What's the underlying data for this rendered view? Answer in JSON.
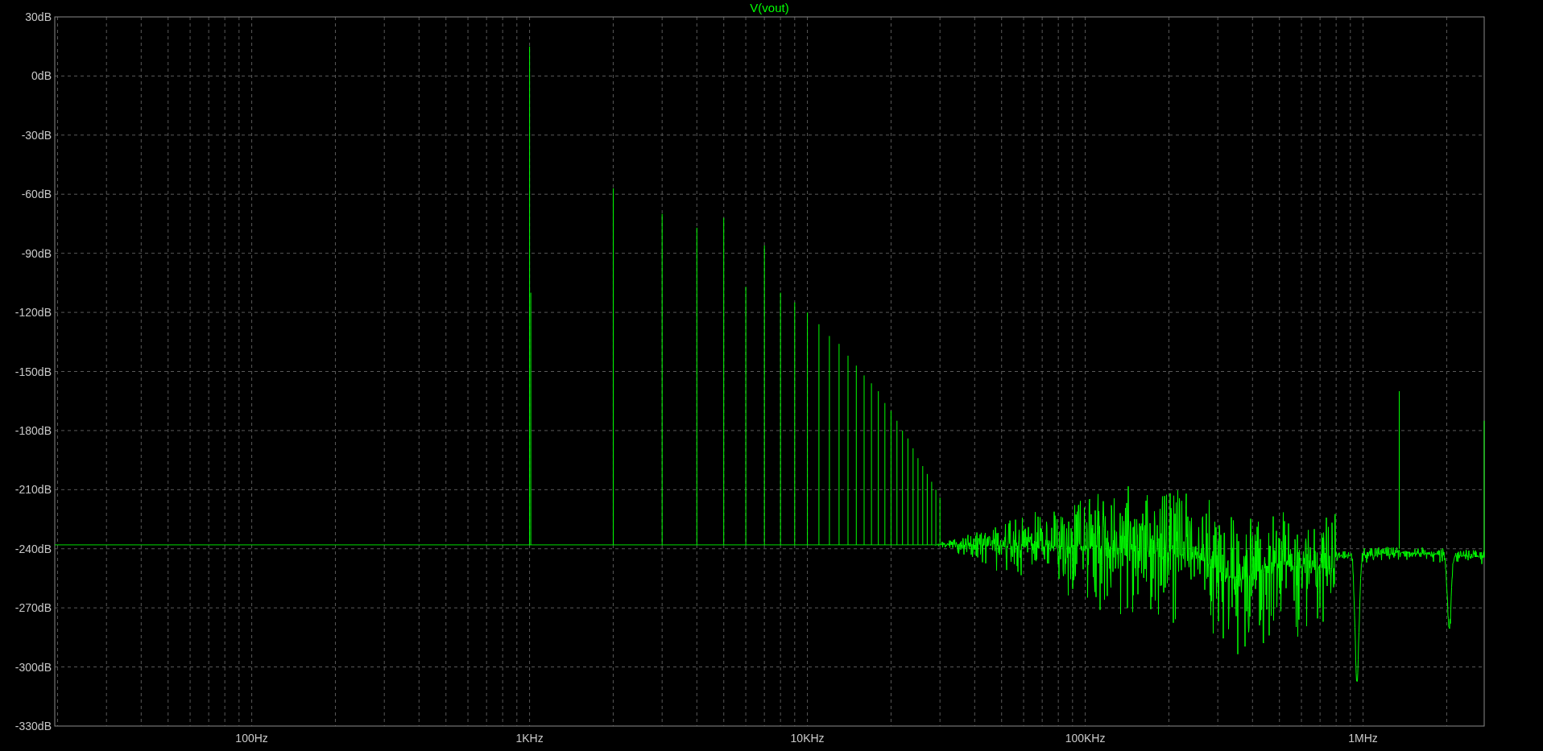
{
  "plot": {
    "title": "V(vout)",
    "y_ticks": [
      "30dB",
      "0dB",
      "-30dB",
      "-60dB",
      "-90dB",
      "-120dB",
      "-150dB",
      "-180dB",
      "-210dB",
      "-240dB",
      "-270dB",
      "-300dB",
      "-330dB"
    ],
    "x_ticks": [
      "100Hz",
      "1KHz",
      "10KHz",
      "100KHz",
      "1MHz"
    ]
  }
}
